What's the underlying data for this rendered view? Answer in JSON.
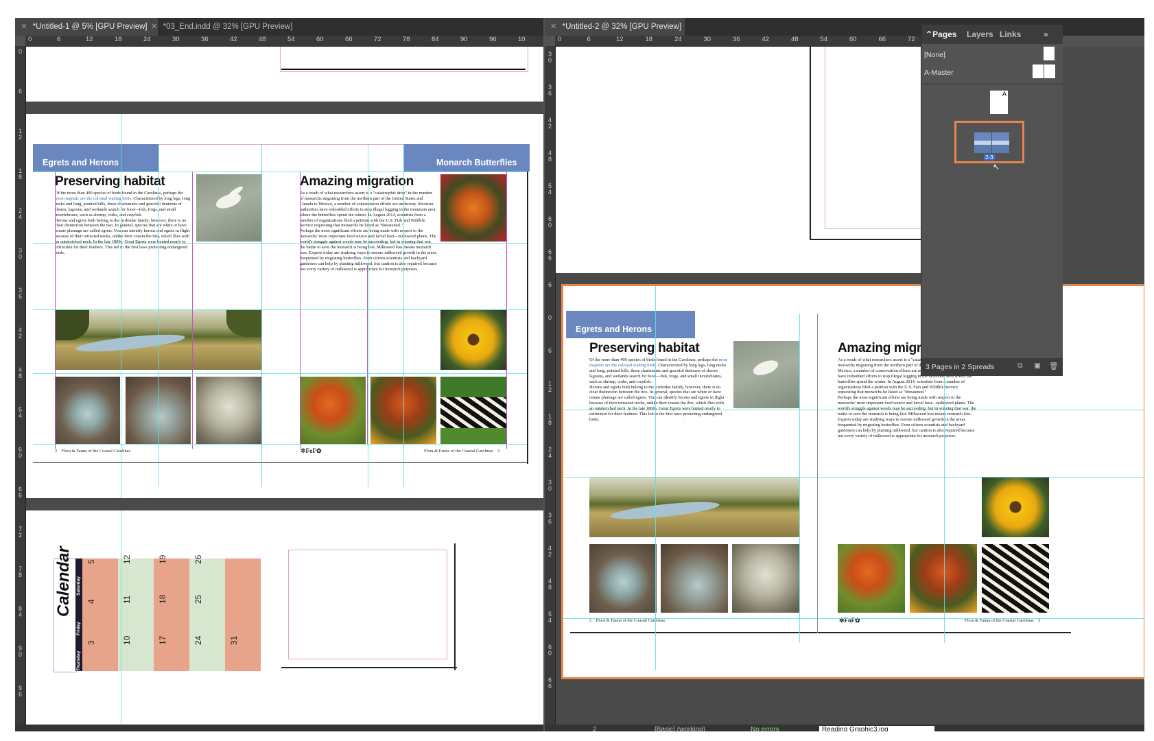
{
  "tabs": {
    "left": [
      {
        "label": "*Untitled-1 @ 5% [GPU Preview]"
      },
      {
        "label": "*03_End.indd @ 32% [GPU Preview]"
      }
    ],
    "right": [
      {
        "label": "*Untitled-2 @ 32% [GPU Preview]"
      }
    ]
  },
  "rulers": {
    "left_top": [
      "0",
      "6",
      "12",
      "18",
      "24",
      "30",
      "36",
      "42",
      "48",
      "54",
      "60",
      "66",
      "72",
      "78",
      "84",
      "90",
      "96",
      "10"
    ],
    "right_top": [
      "0",
      "6",
      "12",
      "18",
      "24",
      "30",
      "36",
      "42",
      "48",
      "54",
      "60",
      "66",
      "72"
    ],
    "left_side": [
      "0",
      "6",
      "1 2",
      "1 8",
      "2 4",
      "3 0",
      "3 6",
      "4 2",
      "4 8",
      "5 4",
      "6 0",
      "6 6",
      "7 2",
      "7 8",
      "8 4",
      "9 0",
      "9 6"
    ],
    "right_side": [
      "3 0",
      "3 6",
      "4 2",
      "4 8",
      "5 4",
      "6 0",
      "6 6",
      "6",
      "0",
      "6",
      "1 2",
      "1 8",
      "2 4",
      "3 0",
      "3 6",
      "4 2",
      "4 8",
      "5 4",
      "6 0",
      "6 6"
    ]
  },
  "spread": {
    "left_banner": "Egrets and Herons",
    "right_banner": "Monarch Butterflies",
    "left_heading": "Preserving habitat",
    "right_heading": "Amazing migration",
    "left_body_1_pre": "Of the more than 400 species of birds found in the Carolinas, perhaps the ",
    "left_body_1_link": "most majestic are the colonial wading birds",
    "left_body_1_post": ". Characterized by long legs, long necks and long, pointed bills, these charismatic and graceful denizens of shores, lagoons, and wetlands search for food—fish, frogs, and small invertebrates, such as shrimp, crabs, and crayfish.",
    "left_body_2": "Herons and egrets both belong to the Ardeidae family, however, there is no clear distinction between the two. In general, species that are white or have ornate plumage are called egrets. You can identify herons and egrets in flight because of their retracted necks, unlike their cousin the ibis, which flies with an outstretched neck. In the late 1800s, Great Egrets were hunted nearly to extinction for their feathers. This led to the first laws protecting endangered birds.",
    "right_body_1": "As a result of what researchers assert is a \"catastrophic drop\" in the number of monarchs migrating from the northern part of the United States and Canada to Mexico, a number of conservation efforts are underway. Mexican authorities have redoubled efforts to stop illegal logging in the mountain area where the butterflies spend the winter. In August 2014, scientists from a number of organizations filed a petition with the U.S. Fish and Wildlife Service requesting that monarchs be listed as \"threatened.\"",
    "right_body_2": "Perhaps the most significant efforts are being made with respect to the monarchs' most important food source and larval host—milkweed plants. The world's struggle against weeds may be succeeding, but in winning that war, the battle to save the monarch is being lost. Milkweed loss means monarch loss. Experts today are studying ways to restore milkweed growth in the areas frequented by migrating butterflies. Even citizen scientists and backyard gardeners can help by planting milkweed, but caution is also required because not every variety of milkweed is appropriate for monarch purposes.",
    "footer_left_num": "2",
    "footer_left_text": "Flora & Fauna of the Coastal Carolinas",
    "footer_right_text": "Flora & Fauna of the Coastal Carolinas",
    "footer_right_num": "3",
    "logo_text": "FoF"
  },
  "right_spread": {
    "banner": "Egrets and Herons",
    "left_heading": "Preserving habitat",
    "right_heading": "Amazing migra",
    "footer_left_num": "2",
    "footer_left_text": "Flora & Fauna of the Coastal Carolinas",
    "footer_right_text": "Flora & Fauna of the Coastal Carolinas",
    "footer_right_num": "3"
  },
  "calendar": {
    "title": "Calendar",
    "days": [
      "Saturday",
      "Friday",
      "Thursday"
    ],
    "dates": [
      [
        "5",
        "12",
        "19",
        "26"
      ],
      [
        "4",
        "11",
        "18",
        "25"
      ],
      [
        "3",
        "10",
        "17",
        "24",
        "31"
      ]
    ]
  },
  "pages_panel": {
    "tabs": [
      "Pages",
      "Layers",
      "Links"
    ],
    "masters": [
      "[None]",
      "A-Master"
    ],
    "spread_label": "2-3",
    "status": "3 Pages in 2 Spreads",
    "master_letter": "A"
  },
  "statusbar": {
    "right_file": "Reading Graphic3.jpg",
    "page_field": "2",
    "errors": "No errors",
    "profile": "[Basic] (working)"
  }
}
